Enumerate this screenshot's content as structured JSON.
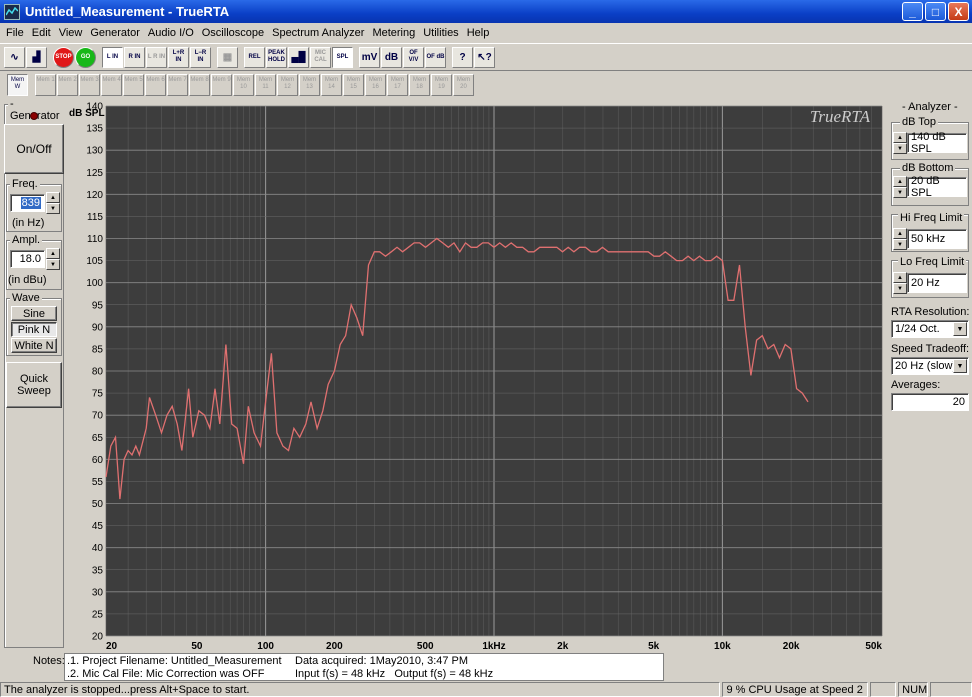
{
  "window": {
    "title": "Untitled_Measurement - TrueRTA",
    "minimize": "_",
    "maximize": "□",
    "close": "X"
  },
  "menu": [
    "File",
    "Edit",
    "View",
    "Generator",
    "Audio I/O",
    "Oscilloscope",
    "Spectrum Analyzer",
    "Metering",
    "Utilities",
    "Help"
  ],
  "toolbar": [
    {
      "name": "sine-wave-icon",
      "label": "∿",
      "state": "normal"
    },
    {
      "name": "spectrum-icon",
      "label": "▟",
      "state": "normal"
    },
    {
      "name": "stop-button",
      "label": "STOP",
      "state": "normal",
      "color": "#e01818"
    },
    {
      "name": "go-button",
      "label": "GO",
      "state": "normal",
      "color": "#18b818"
    },
    {
      "name": "left-in-button",
      "label": "L IN",
      "state": "on"
    },
    {
      "name": "right-in-button",
      "label": "R IN",
      "state": "normal"
    },
    {
      "name": "l-r-in-button",
      "label": "L R IN",
      "state": "disabled"
    },
    {
      "name": "l-plus-r-in-button",
      "label": "L+R IN",
      "state": "normal"
    },
    {
      "name": "l-minus-r-in-button",
      "label": "L−R IN",
      "state": "normal"
    },
    {
      "name": "grid-icon",
      "label": "▦",
      "state": "disabled"
    },
    {
      "name": "rel-button",
      "label": "REL",
      "state": "normal"
    },
    {
      "name": "peak-hold-button",
      "label": "PEAK HOLD",
      "state": "normal"
    },
    {
      "name": "bars-button",
      "label": "▄█",
      "state": "normal"
    },
    {
      "name": "mic-cal-button",
      "label": "MIC CAL",
      "state": "disabled"
    },
    {
      "name": "spl-button",
      "label": "SPL",
      "state": "on"
    },
    {
      "name": "mv-button",
      "label": "mV",
      "state": "normal"
    },
    {
      "name": "db-button",
      "label": "dB",
      "state": "normal"
    },
    {
      "name": "of-vv-button",
      "label": "OF V/V",
      "state": "normal"
    },
    {
      "name": "of-db-button",
      "label": "OF dB",
      "state": "normal"
    },
    {
      "name": "help-icon",
      "label": "?",
      "state": "normal"
    },
    {
      "name": "context-help-icon",
      "label": "↖?",
      "state": "normal"
    }
  ],
  "memories": [
    "Mem W",
    "Mem 1",
    "Mem 2",
    "Mem 3",
    "Mem 4",
    "Mem 5",
    "Mem 6",
    "Mem 7",
    "Mem 8",
    "Mem 9",
    "Mem 10",
    "Mem 11",
    "Mem 12",
    "Mem 13",
    "Mem 14",
    "Mem 15",
    "Mem 16",
    "Mem 17",
    "Mem 18",
    "Mem 19",
    "Mem 20"
  ],
  "generator": {
    "title": "Generator",
    "onoff": "On/Off",
    "freq_label": "Freq.",
    "freq_value": "839",
    "freq_unit": "(in Hz)",
    "ampl_label": "Ampl.",
    "ampl_value": "18.0",
    "ampl_unit": "(in dBu)",
    "wave_label": "Wave",
    "waves": [
      "Sine",
      "Pink N",
      "White N"
    ],
    "selected_wave": "Pink N",
    "quick_sweep": "Quick Sweep"
  },
  "analyzer": {
    "title": "Analyzer",
    "db_top_label": "dB Top",
    "db_top_value": "140 dB SPL",
    "db_bottom_label": "dB Bottom",
    "db_bottom_value": "20 dB SPL",
    "hi_freq_label": "Hi Freq Limit",
    "hi_freq_value": "50 kHz",
    "lo_freq_label": "Lo Freq Limit",
    "lo_freq_value": "20 Hz",
    "rta_res_label": "RTA Resolution:",
    "rta_res_value": "1/24 Oct.",
    "speed_label": "Speed Tradeoff:",
    "speed_value": "20 Hz (slow)",
    "averages_label": "Averages:",
    "averages_value": "20"
  },
  "chart_data": {
    "type": "line",
    "logo": "TrueRTA",
    "ylabel": "dB SPL",
    "xscale": "log",
    "ylim": [
      20,
      140
    ],
    "xlim": [
      20,
      50000
    ],
    "yticks": [
      20,
      25,
      30,
      35,
      40,
      45,
      50,
      55,
      60,
      65,
      70,
      75,
      80,
      85,
      90,
      95,
      100,
      105,
      110,
      115,
      120,
      125,
      130,
      135,
      140
    ],
    "xtick_values": [
      20,
      50,
      100,
      200,
      500,
      1000,
      2000,
      5000,
      10000,
      20000,
      50000
    ],
    "xtick_labels": [
      "20",
      "50",
      "100",
      "200",
      "500",
      "1kHz",
      "2k",
      "5k",
      "10k",
      "20k",
      "50k"
    ],
    "grid": true,
    "line_color": "#e07070",
    "background": "#3d3d3d",
    "series": [
      {
        "x": [
          20,
          21,
          22,
          23,
          24,
          25,
          26,
          27,
          28,
          30,
          31,
          33,
          35,
          37,
          39,
          41,
          43,
          46,
          48,
          51,
          54,
          57,
          60,
          63,
          67,
          71,
          75,
          80,
          84,
          89,
          95,
          100,
          106,
          112,
          119,
          126,
          133,
          141,
          150,
          158,
          168,
          178,
          188,
          200,
          212,
          224,
          237,
          251,
          266,
          282,
          299,
          316,
          335,
          355,
          376,
          398,
          422,
          447,
          473,
          501,
          531,
          562,
          596,
          631,
          668,
          708,
          750,
          794,
          841,
          891,
          944,
          1000,
          1059,
          1122,
          1189,
          1259,
          1334,
          1413,
          1496,
          1585,
          1679,
          1778,
          1884,
          1995,
          2113,
          2239,
          2371,
          2512,
          2661,
          2818,
          2985,
          3162,
          3350,
          3548,
          3758,
          3981,
          4217,
          4467,
          4732,
          5012,
          5309,
          5623,
          5957,
          6310,
          6683,
          7079,
          7499,
          7943,
          8414,
          8913,
          9441,
          10000,
          10593,
          11220,
          11885,
          12589,
          13335,
          14125,
          14962,
          15849,
          16788,
          17783,
          18836,
          19953,
          21135,
          22387,
          23714
        ],
        "y": [
          56,
          63,
          65,
          51,
          60,
          62,
          61,
          63,
          61,
          67,
          74,
          70,
          66,
          70,
          72,
          68,
          62,
          76,
          65,
          71,
          70,
          67,
          76,
          68,
          86,
          68,
          67,
          59,
          72,
          66,
          63,
          73,
          84,
          66,
          63,
          62,
          67,
          65,
          68,
          73,
          67,
          71,
          77,
          80,
          86,
          88,
          95,
          92,
          88,
          104,
          107,
          107,
          106,
          107,
          108,
          107,
          108,
          109,
          109,
          108,
          109,
          110,
          109,
          108,
          109,
          107,
          109,
          108,
          108,
          109,
          109,
          108,
          109,
          108,
          109,
          108,
          108,
          107,
          107,
          108,
          108,
          108,
          108,
          107,
          108,
          107,
          108,
          108,
          107,
          107,
          108,
          107,
          107,
          107,
          107,
          107,
          107,
          107,
          107,
          106,
          106,
          107,
          106,
          105,
          105,
          106,
          105,
          106,
          105,
          105,
          106,
          105,
          96,
          96,
          104,
          90,
          79,
          87,
          88,
          85,
          86,
          83,
          86,
          85,
          76,
          75,
          73
        ]
      }
    ]
  },
  "notes": {
    "label": "Notes:",
    "line1": ".1. Project Filename: Untitled_Measurement",
    "line2": ".2. Mic Cal File: Mic Correction was OFF",
    "data_acquired": "Data acquired: 1May2010, 3:47 PM",
    "io_rate": "Input f(s) = 48 kHz   Output f(s) = 48 kHz"
  },
  "status": {
    "message": "The analyzer is stopped...press Alt+Space to start.",
    "cpu": "9 % CPU Usage at Speed 2",
    "num": "NUM"
  }
}
